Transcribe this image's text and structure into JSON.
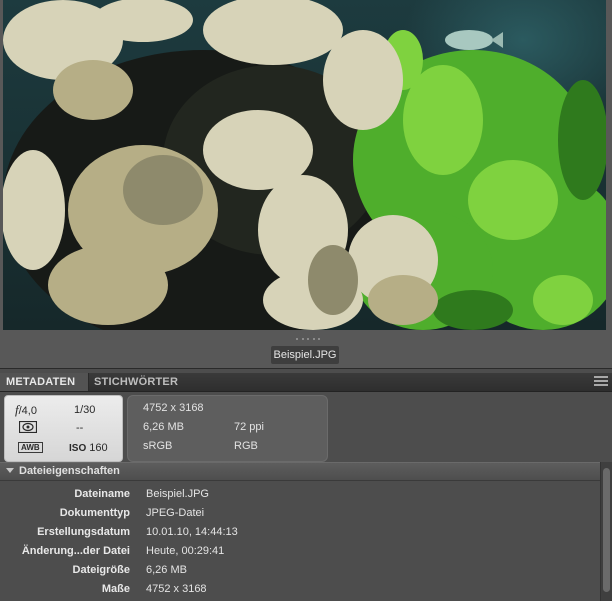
{
  "preview": {
    "filename": "Beispiel.JPG"
  },
  "tabs": [
    {
      "label": "METADATEN",
      "active": true
    },
    {
      "label": "STICHWÖRTER",
      "active": false
    }
  ],
  "camera": {
    "aperture_symbol": "f",
    "aperture": "/4,0",
    "shutter": "1/30",
    "metering": "--",
    "iso_label": "ISO",
    "iso": "160",
    "wb_badge": "AWB",
    "metering_icon": "metering-icon"
  },
  "file_info": {
    "dimensions": "4752 x 3168",
    "size": "6,26 MB",
    "resolution": "72 ppi",
    "profile": "sRGB",
    "color_mode": "RGB"
  },
  "section": {
    "title": "Dateieigenschaften"
  },
  "properties": [
    {
      "key": "Dateiname",
      "value": "Beispiel.JPG"
    },
    {
      "key": "Dokumenttyp",
      "value": "JPEG-Datei"
    },
    {
      "key": "Erstellungsdatum",
      "value": "10.01.10, 14:44:13"
    },
    {
      "key": "Änderung...der Datei",
      "value": "Heute, 00:29:41"
    },
    {
      "key": "Dateigröße",
      "value": "6,26 MB"
    },
    {
      "key": "Maße",
      "value": "4752 x 3168"
    }
  ],
  "colors": {
    "panel_bg": "#4d4d4d",
    "camera_box_bg": "#e4e4e4",
    "text_light": "#e4e4e4"
  }
}
